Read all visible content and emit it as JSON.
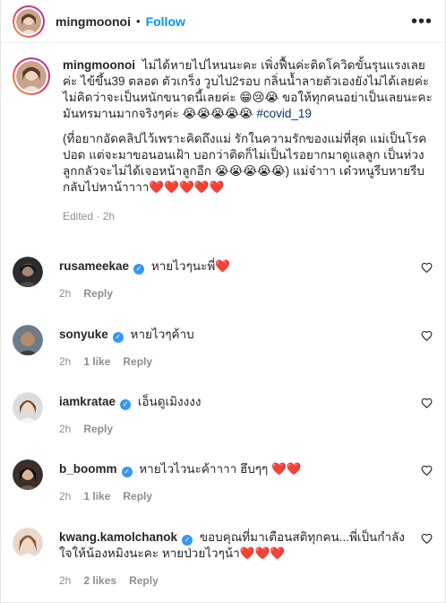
{
  "header": {
    "username": "mingmoonoi",
    "separator": "•",
    "follow_label": "Follow",
    "more_label": "•••"
  },
  "caption": {
    "username": "mingmoonoi",
    "text1": "ไม่ได้หายไปไหนนะคะ เพิ่งฟื้นค่ะติดโควิดขั้นรุนแรงเลยค่ะ ไข้ขึ้น39 ตลอด ตัวเกร็ง วูบไป2รอบ กลิ่นน้ำลายตัวเองยังไม่ได้เลยค่ะ ไม่คิดว่าจะเป็นหนักขนาดนี้เลยค่ะ 😁😢😭 ขอให้ทุกคนอย่าเป็นเลยนะคะ มันทรมานมากจริงๆค่ะ 😭😭😭😭😭",
    "hashtag": "#covid_19",
    "text2": "(ที่อยากอัดคลิปไว้เพราะคิดถึงแม่ รักในความรักของแม่ที่สุด แม่เป็นโรคปอด แต่จะมาขอนอนเฝ้า บอกว่าติดก็ไม่เป็นไรอยากมาดูแลลูก เป็นห่วงลูกกลัวจะไม่ได้เจอหน้าลูกอีก 😭😭😭😭😭) แม่จ๋าาา เด๋วหนูรีบหายรีบกลับไปหาน้าาาา❤️❤️❤️❤️❤️",
    "edited": "Edited · 2h"
  },
  "comments": [
    {
      "username": "rusameekae",
      "verified": true,
      "text": "หายไวๆนะพี่❤️",
      "time": "2h",
      "likes": "",
      "reply": "Reply"
    },
    {
      "username": "sonyuke",
      "verified": true,
      "text": "หายไวๆค้าบ",
      "time": "2h",
      "likes": "1 like",
      "reply": "Reply"
    },
    {
      "username": "iamkratae",
      "verified": true,
      "text": "เอ็นดูเมิงงงง",
      "time": "2h",
      "likes": "",
      "reply": "Reply"
    },
    {
      "username": "b_boomm",
      "verified": true,
      "text": "หายไวไวนะค้าาาา ฮึบๆๆ ❤️❤️",
      "time": "2h",
      "likes": "1 like",
      "reply": "Reply"
    },
    {
      "username": "kwang.kamolchanok",
      "verified": true,
      "text": "ขอบคุณที่มาเตือนสติทุกคน...พี่เป็นกำลังใจให้น้องหมิงนะคะ หายป่วยไวๆน้า❤️❤️❤️",
      "time": "2h",
      "likes": "2 likes",
      "reply": "Reply"
    }
  ],
  "colors": {
    "link": "#0095f6",
    "hashtag": "#00376b",
    "meta": "#8e8e8e",
    "verified": "#3897f0"
  }
}
